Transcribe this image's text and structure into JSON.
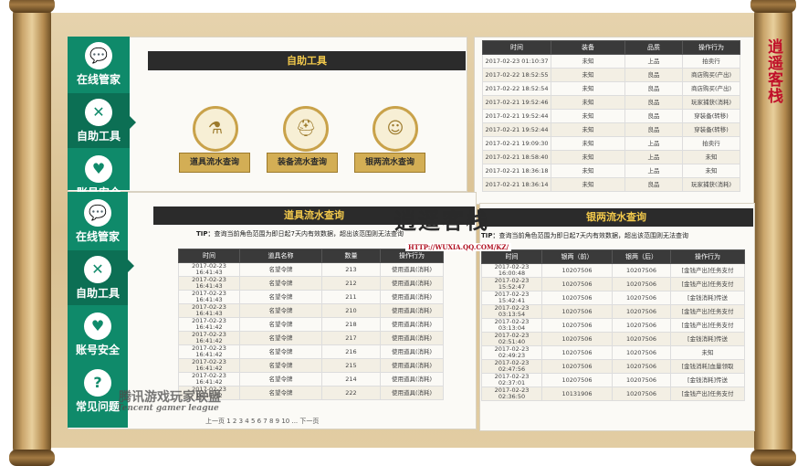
{
  "seal_text": "逍遥客栈",
  "sidebar_top": [
    {
      "icon": "chat",
      "label": "在线管家"
    },
    {
      "icon": "tools",
      "label": "自助工具"
    },
    {
      "icon": "shield",
      "label": "账号安全"
    }
  ],
  "sidebar_bottom": [
    {
      "icon": "chat",
      "label": "在线管家"
    },
    {
      "icon": "tools",
      "label": "自助工具"
    },
    {
      "icon": "shield",
      "label": "账号安全"
    },
    {
      "icon": "question",
      "label": "常见问题"
    }
  ],
  "tools": {
    "title": "自助工具",
    "items": [
      {
        "icon": "flask",
        "label": "道具流水查询"
      },
      {
        "icon": "helmet",
        "label": "装备流水查询"
      },
      {
        "icon": "person",
        "label": "银两流水查询"
      }
    ]
  },
  "equip_table": {
    "headers": [
      "时间",
      "装备",
      "品质",
      "操作行为"
    ],
    "rows": [
      [
        "2017-02-23 01:10:37",
        "未知",
        "上品",
        "拍卖行"
      ],
      [
        "2017-02-22 18:52:55",
        "未知",
        "良品",
        "商店购买(产出)"
      ],
      [
        "2017-02-22 18:52:54",
        "未知",
        "良品",
        "商店购买(产出)"
      ],
      [
        "2017-02-21 19:52:46",
        "未知",
        "良品",
        "玩家捕获(消耗)"
      ],
      [
        "2017-02-21 19:52:44",
        "未知",
        "良品",
        "穿装备(转移)"
      ],
      [
        "2017-02-21 19:52:44",
        "未知",
        "良品",
        "穿装备(转移)"
      ],
      [
        "2017-02-21 19:09:30",
        "未知",
        "上品",
        "拍卖行"
      ],
      [
        "2017-02-21 18:58:40",
        "未知",
        "上品",
        "未知"
      ],
      [
        "2017-02-21 18:36:18",
        "未知",
        "上品",
        "未知"
      ],
      [
        "2017-02-21 18:36:14",
        "未知",
        "良品",
        "玩家捕获(消耗)"
      ]
    ]
  },
  "item_flow": {
    "title": "道具流水查询",
    "tip_label": "TIP：",
    "tip_text": "查询当前角色范围为即日起7天内有效数据，超出该范围则无法查询",
    "headers": [
      "时间",
      "道具名称",
      "数量",
      "操作行为"
    ],
    "rows": [
      [
        "2017-02-23 16:41:43",
        "名望令牌",
        "213",
        "使用道具(消耗)"
      ],
      [
        "2017-02-23 16:41:43",
        "名望令牌",
        "212",
        "使用道具(消耗)"
      ],
      [
        "2017-02-23 16:41:43",
        "名望令牌",
        "211",
        "使用道具(消耗)"
      ],
      [
        "2017-02-23 16:41:43",
        "名望令牌",
        "210",
        "使用道具(消耗)"
      ],
      [
        "2017-02-23 16:41:42",
        "名望令牌",
        "218",
        "使用道具(消耗)"
      ],
      [
        "2017-02-23 16:41:42",
        "名望令牌",
        "217",
        "使用道具(消耗)"
      ],
      [
        "2017-02-23 16:41:42",
        "名望令牌",
        "216",
        "使用道具(消耗)"
      ],
      [
        "2017-02-23 16:41:42",
        "名望令牌",
        "215",
        "使用道具(消耗)"
      ],
      [
        "2017-02-23 16:41:42",
        "名望令牌",
        "214",
        "使用道具(消耗)"
      ],
      [
        "2017-02-23 16:41:42",
        "名望令牌",
        "222",
        "使用道具(消耗)"
      ]
    ]
  },
  "money_flow": {
    "title": "银两流水查询",
    "tip_label": "TIP：",
    "tip_text": "查询当前角色范围为即日起7天内有效数据，超出该范围则无法查询",
    "headers": [
      "时间",
      "银两（前）",
      "银两（后）",
      "操作行为"
    ],
    "rows": [
      [
        "2017-02-23 16:00:48",
        "10207506",
        "10207506",
        "[金钱产出]任务支付"
      ],
      [
        "2017-02-23 15:52:47",
        "10207506",
        "10207506",
        "[金钱产出]任务支付"
      ],
      [
        "2017-02-23 15:42:41",
        "10207506",
        "10207506",
        "[金钱消耗]传送"
      ],
      [
        "2017-02-23 03:13:54",
        "10207506",
        "10207506",
        "[金钱产出]任务支付"
      ],
      [
        "2017-02-23 03:13:04",
        "10207506",
        "10207506",
        "[金钱产出]任务支付"
      ],
      [
        "2017-02-23 02:51:40",
        "10207506",
        "10207506",
        "[金钱消耗]传送"
      ],
      [
        "2017-02-23 02:49:23",
        "10207506",
        "10207506",
        "未知"
      ],
      [
        "2017-02-23 02:47:56",
        "10207506",
        "10207506",
        "[金钱消耗]血量领取"
      ],
      [
        "2017-02-23 02:37:01",
        "10207506",
        "10207506",
        "[金钱消耗]传送"
      ],
      [
        "2017-02-23 02:36:50",
        "10131906",
        "10207506",
        "[金钱产出]任务支付"
      ]
    ]
  },
  "partial_bottom": "上一页 1 2 3 4 5 6 7 8 9 10 ... 下一页",
  "watermark": {
    "title": "逍遥客栈",
    "url": "HTTP://WUXIA.QQ.COM/KZ/",
    "league": "腾讯游戏玩家联盟",
    "league_en": "Tencent gamer league"
  }
}
